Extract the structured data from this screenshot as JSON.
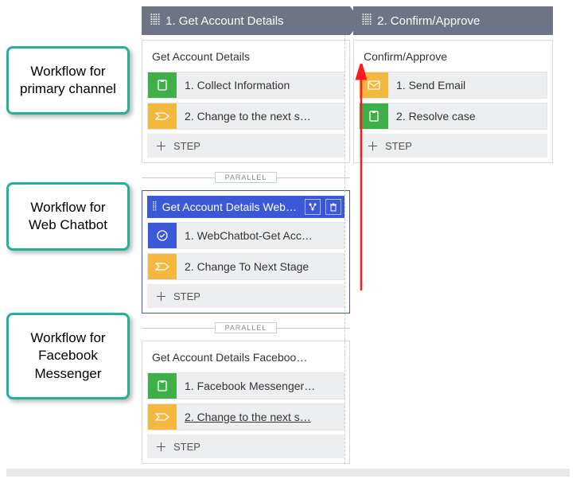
{
  "labels": {
    "primary": "Workflow for primary channel",
    "webchat": "Workflow for Web Chatbot",
    "facebook": "Workflow for Facebook Messenger"
  },
  "stage1": {
    "header": "1.   Get Account Details",
    "parallel_label": "PARALLEL",
    "card_primary": {
      "title": "Get Account Details",
      "step1": "1.  Collect Information",
      "step2": "2.  Change to the next s…",
      "add": "STEP"
    },
    "card_webchat": {
      "title": "Get Account Details WebChat",
      "step1": "1.  WebChatbot-Get Acc…",
      "step2": "2.  Change To Next Stage",
      "add": "STEP"
    },
    "card_facebook": {
      "title": "Get Account Details Faceboo…",
      "step1": "1.  Facebook Messenger…",
      "step2": "2.  Change to the next s…",
      "add": "STEP"
    }
  },
  "stage2": {
    "header": "2.   Confirm/Approve",
    "card_primary": {
      "title": "Confirm/Approve",
      "step1": "1.  Send Email",
      "step2": "2.  Resolve case",
      "add": "STEP"
    }
  }
}
